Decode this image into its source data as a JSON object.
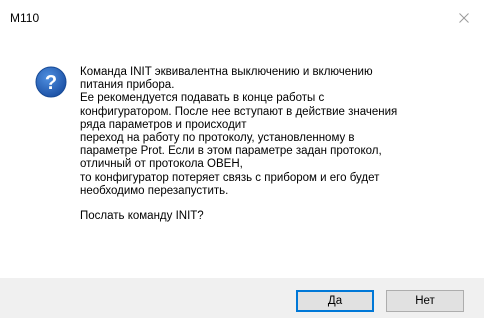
{
  "window": {
    "title": "M110",
    "close_icon": "close-icon"
  },
  "dialog": {
    "icon": "question-icon",
    "message_lines": [
      "Команда INIT эквивалентна выключению и включению",
      "питания прибора.",
      "Ее рекомендуется подавать в конце работы с",
      "конфигуратором. После нее вступают в действие значения",
      "ряда параметров и происходит",
      "переход на работу по протоколу, установленному в",
      "параметре Prot. Если в этом параметре задан протокол,",
      "отличный от протокола ОВЕН,",
      "то конфигуратор потеряет связь с прибором и его будет",
      "необходимо перезапустить."
    ],
    "question": "Послать команду INIT?"
  },
  "buttons": {
    "yes_label": "Да",
    "no_label": "Нет"
  },
  "colors": {
    "accent": "#0078d7",
    "icon_fill": "#1e5fb4",
    "footer_bg": "#f0f0f0"
  }
}
